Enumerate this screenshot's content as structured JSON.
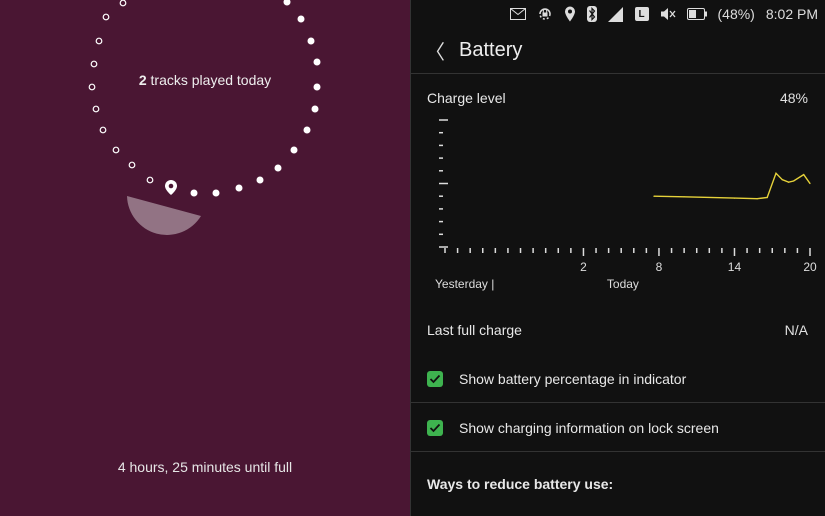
{
  "lock": {
    "tracks_count": "2",
    "tracks_text": " tracks played today",
    "charge_text": "4 hours, 25 minutes until full",
    "colors": {
      "background": "#4a1633",
      "dot": "#ffffff"
    }
  },
  "statusbar": {
    "battery_percent": "(48%)",
    "time": "8:02 PM",
    "lang": "L"
  },
  "header": {
    "title": "Battery",
    "back_label": "〈"
  },
  "charge": {
    "label": "Charge level",
    "value": "48%"
  },
  "chart_data": {
    "type": "line",
    "title": "",
    "xlabel": "",
    "ylabel": "",
    "tick_labels": [
      "2",
      "8",
      "14",
      "20"
    ],
    "day_labels": [
      "Yesterday |",
      "Today"
    ],
    "ylim": [
      0,
      100
    ],
    "x_hours": [
      7.6,
      10,
      14,
      15.8,
      16.6,
      17.3,
      17.8,
      18.3,
      18.7,
      19.5,
      20
    ],
    "y_percent": [
      40,
      39.5,
      38.5,
      38,
      39,
      58,
      53,
      51,
      52,
      57,
      50
    ],
    "series_color": "#e6d23a"
  },
  "last_full_charge": {
    "label": "Last full charge",
    "value": "N/A"
  },
  "options": [
    {
      "label": "Show battery percentage in indicator",
      "checked": true
    },
    {
      "label": "Show charging information on lock screen",
      "checked": true
    }
  ],
  "ways": {
    "label": "Ways to reduce battery use:"
  }
}
